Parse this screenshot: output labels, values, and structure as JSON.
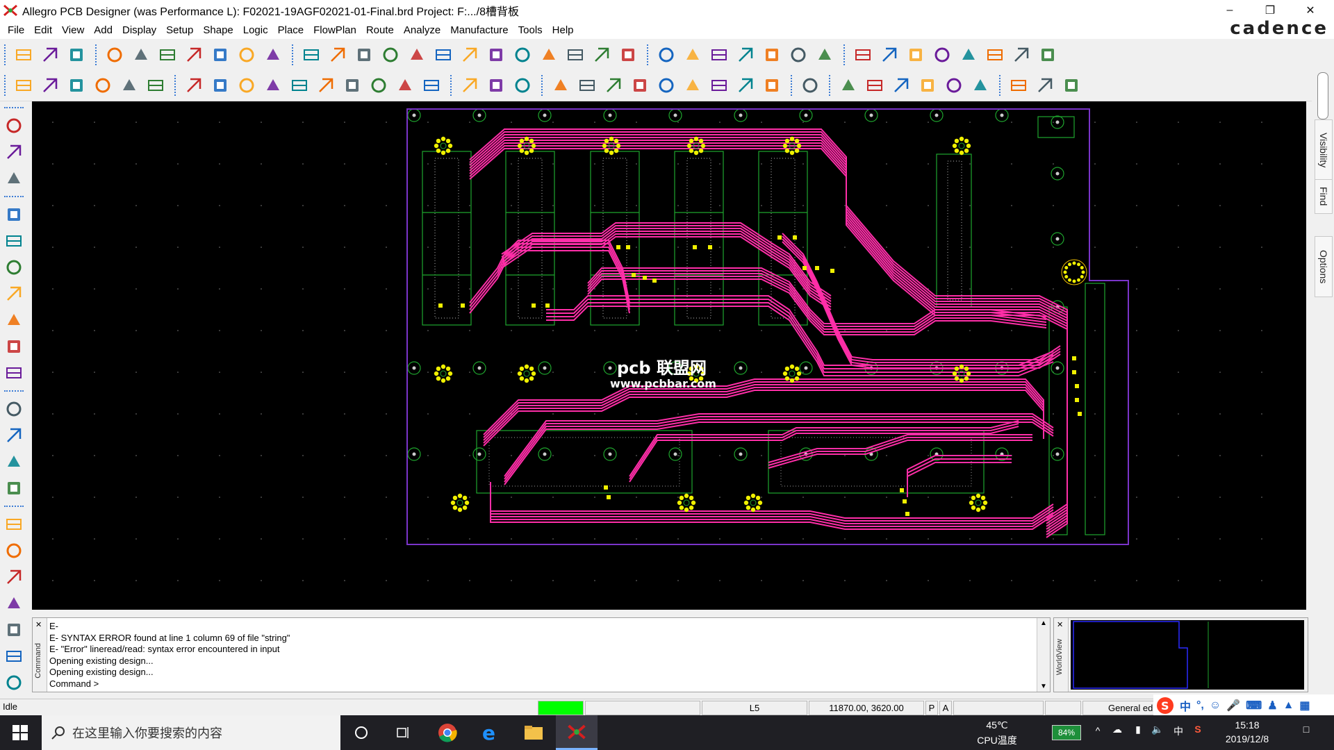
{
  "window": {
    "title": "Allegro PCB Designer (was Performance L): F02021-19AGF02021-01-Final.brd  Project: F:.../8槽背板",
    "brand": "cadence"
  },
  "menu": [
    "File",
    "Edit",
    "View",
    "Add",
    "Display",
    "Setup",
    "Shape",
    "Logic",
    "Place",
    "FlowPlan",
    "Route",
    "Analyze",
    "Manufacture",
    "Tools",
    "Help"
  ],
  "toolbar1_icons": [
    "new-icon",
    "open-icon",
    "save-icon",
    "move-icon",
    "copy-icon",
    "delete-icon",
    "undo-icon",
    "undo-list-icon",
    "redo-icon",
    "redo-list-icon",
    "ratsnest-icon",
    "pin-icon",
    "grid-icon",
    "zoom-fit-icon",
    "zoom-window-icon",
    "zoom-in-icon",
    "zoom-out-icon",
    "zoom-world-icon",
    "zoom-previous-icon",
    "zoom-center-icon",
    "redraw-icon",
    "3d-view-icon",
    "flip-icon",
    "snap-grid-icon",
    "color-icon",
    "layer-icon",
    "shadow-icon",
    "stack-icon",
    "spreadsheet-icon",
    "globe-icon",
    "info-icon",
    "measure-icon",
    "counter-icon",
    "highlight-icon",
    "sun-icon",
    "lightbulb-icon",
    "hourglass-icon",
    "drc-icon"
  ],
  "toolbar2_icons": [
    "place-manual-icon",
    "place-icon",
    "swap-icon",
    "route-icon",
    "fanout-icon",
    "blank-icon",
    "add-connect-icon",
    "rect-icon",
    "circle-icon",
    "select-icon",
    "slide-icon",
    "arc-icon",
    "square-icon",
    "octagon-icon",
    "shape-icon",
    "via-icon",
    "package-icon",
    "dimension-icon",
    "measure-line-icon",
    "odb-icon",
    "library-icon",
    "symbol-icon",
    "camera-icon",
    "ref-des-icon",
    "flag-icon",
    "matrix-icon",
    "key-icon",
    "array-icon",
    "wave-icon",
    "film-icon",
    "book-icon",
    "mail-icon",
    "check-icon",
    "tool-icon",
    "window-icon",
    "scene-icon",
    "pin-swap-icon",
    "help-icon"
  ],
  "left_toolbar_icons": [
    "place-component-icon",
    "u1-icon",
    "resistor-icon",
    "route-connect-icon",
    "spread-icon",
    "delay-tune-icon",
    "fanout-left-icon",
    "vias-icon",
    "gloss-icon",
    "phase-icon",
    "line-icon",
    "rectangle-icon",
    "add-text-icon",
    "edit-text-icon",
    "auto-route-icon",
    "route-slide-icon",
    "route-unroute-icon",
    "net-icon",
    "group-icon",
    "matrix-left-icon",
    "bottom-icon"
  ],
  "right_panel": {
    "tabs": [
      "Visibility",
      "Find",
      "Options"
    ]
  },
  "watermark": {
    "logo_text": "pcb 联盟网",
    "url": "www.pcbbar.com"
  },
  "console": {
    "label": "Command",
    "lines": [
      "E-",
      "E- SYNTAX ERROR found at line 1 column 69 of file \"string\"",
      "E- \"Error\" lineread/read: syntax error encountered in input",
      "Opening existing design...",
      "Opening existing design...",
      "Command >"
    ]
  },
  "worldview": {
    "label": "WorldView"
  },
  "status": {
    "state": "Idle",
    "layer": "L5",
    "coordinates": "11870.00, 3620.00",
    "p_flag": "P",
    "a_flag": "A",
    "mode": "General edit",
    "indicator_color": "#00ff00"
  },
  "taskbar": {
    "search_placeholder": "在这里输入你要搜索的内容",
    "temperature": "45℃",
    "temperature_label": "CPU温度",
    "battery": "84%",
    "ime_lang": "中",
    "time": "15:18",
    "date": "2019/12/8"
  },
  "colors": {
    "trace": "#ff2ea8",
    "outline": "#7a34c9",
    "footprint": "#1fa62e",
    "pad": "#f0f000",
    "grid_dot": "#ffffff"
  }
}
